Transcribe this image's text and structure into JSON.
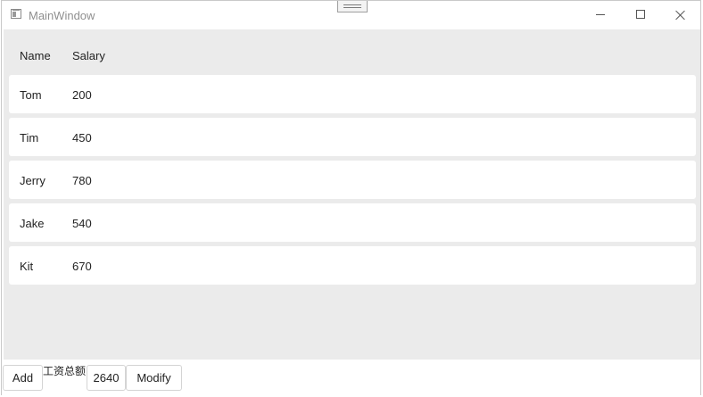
{
  "window": {
    "title": "MainWindow",
    "icons": {
      "app": "window-app-icon",
      "minimize": "minimize-icon",
      "maximize": "maximize-icon",
      "close": "close-icon"
    }
  },
  "table": {
    "columns": [
      "Name",
      "Salary"
    ],
    "rows": [
      {
        "name": "Tom",
        "salary": "200"
      },
      {
        "name": "Tim",
        "salary": "450"
      },
      {
        "name": "Jerry",
        "salary": "780"
      },
      {
        "name": "Jake",
        "salary": "540"
      },
      {
        "name": "Kit",
        "salary": "670"
      }
    ]
  },
  "footer": {
    "add_label": "Add",
    "total_label": "工资总额",
    "total_value": "2640",
    "modify_label": "Modify"
  },
  "colors": {
    "list_background": "#ebebeb",
    "row_background": "#ffffff",
    "title_text": "#8f8f8f"
  }
}
